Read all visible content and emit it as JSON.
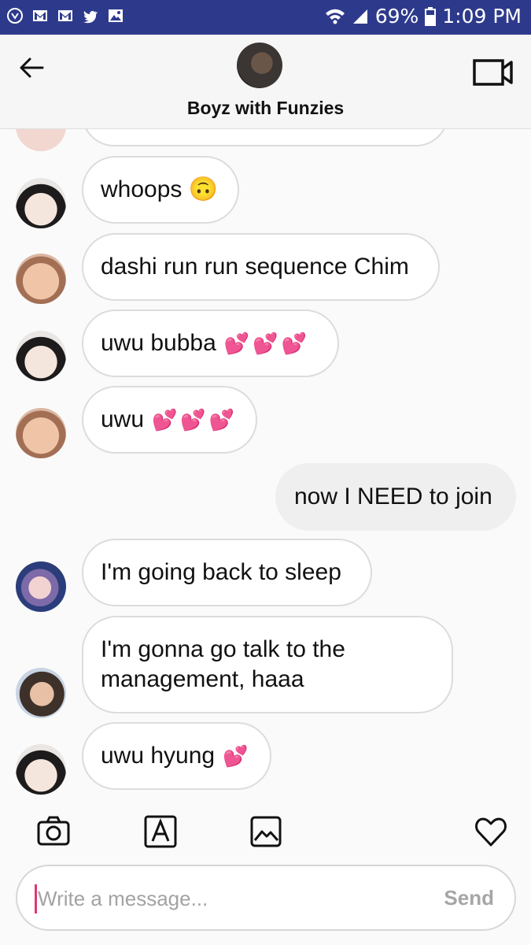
{
  "status_bar": {
    "battery": "69%",
    "time": "1:09 PM",
    "left_icons": [
      "app-icon",
      "gmail-icon",
      "gmail-icon",
      "twitter-icon",
      "gallery-icon"
    ],
    "right_icons": [
      "wifi-icon",
      "signal-icon",
      "battery-icon"
    ]
  },
  "header": {
    "title": "Boyz with Funzies",
    "back_icon": "arrow-left-icon",
    "video_icon": "video-camera-icon"
  },
  "messages": [
    {
      "id": "m1",
      "sender": "incoming",
      "text": "whoops 🙃",
      "avatar": "avatar-a"
    },
    {
      "id": "m2",
      "sender": "incoming",
      "text": "dashi run run sequence Chim",
      "avatar": "avatar-b"
    },
    {
      "id": "m3",
      "sender": "incoming",
      "text": "uwu bubba",
      "hearts": "💕💕💕",
      "avatar": "avatar-a"
    },
    {
      "id": "m4",
      "sender": "incoming",
      "text": "uwu",
      "hearts": "💕💕💕",
      "avatar": "avatar-b"
    },
    {
      "id": "m5",
      "sender": "outgoing",
      "text": "now I NEED to join"
    },
    {
      "id": "m6",
      "sender": "incoming",
      "text": "I'm going back to sleep",
      "avatar": "avatar-c"
    },
    {
      "id": "m7",
      "sender": "incoming",
      "text_line1": "I'm gonna go talk to the",
      "text_line2": "management, haaa",
      "avatar": "avatar-d"
    },
    {
      "id": "m8",
      "sender": "incoming",
      "text": "uwu hyung",
      "hearts": "💕",
      "avatar": "avatar-a"
    }
  ],
  "toolbar": {
    "icons": [
      "camera-icon",
      "text-style-icon",
      "gallery-icon",
      "heart-icon"
    ]
  },
  "composer": {
    "placeholder": "Write a message...",
    "send_label": "Send"
  },
  "colors": {
    "status_bar": "#2d3a8c",
    "caret": "#e4366f",
    "hearts": "#ff3d8b"
  }
}
